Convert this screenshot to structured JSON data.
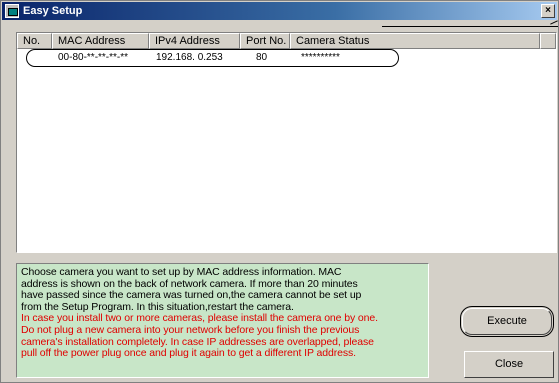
{
  "window": {
    "title": "Easy Setup",
    "close_glyph": "×"
  },
  "list": {
    "columns": [
      "No.",
      "MAC Address",
      "IPv4 Address",
      "Port No.",
      "Camera Status"
    ],
    "rows": [
      {
        "no": "",
        "mac": "00-80-**-**-**-**",
        "ipv4": "192.168.  0.253",
        "port": "80",
        "status": "**********"
      }
    ]
  },
  "info": {
    "black_lines": [
      "Choose camera you want to set up by MAC address information. MAC",
      "address is shown on the back of network camera. If more than 20 minutes",
      "have passed since the camera was turned on,the camera cannot be set up",
      "from the Setup Program. In this situation,restart the camera."
    ],
    "red_lines": [
      "In case you install two or more cameras, please install the camera one by one.",
      "Do not plug a new camera into your network before you finish the previous",
      "camera's installation completely. In case IP addresses are overlapped, please",
      "pull off the power plug once and plug it again to get a different IP address."
    ],
    "colors": {
      "background": "#c8e6c8",
      "warning_text": "#e00000"
    }
  },
  "buttons": {
    "execute": "Execute",
    "close": "Close"
  },
  "icons": {
    "title": "app-icon",
    "close": "close-icon"
  }
}
